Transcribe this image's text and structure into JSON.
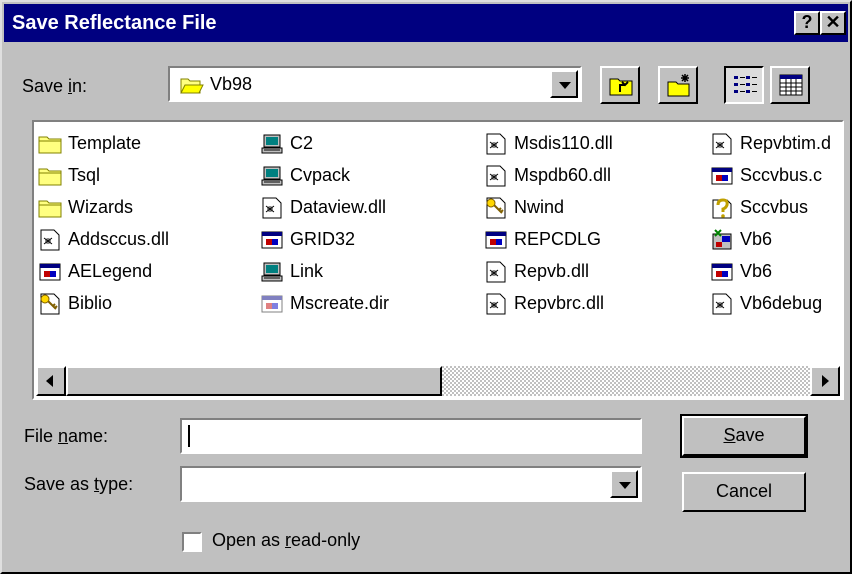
{
  "window": {
    "title": "Save Reflectance File",
    "help_glyph": "?",
    "close_glyph": "✕"
  },
  "save_in": {
    "label_pre": "Save ",
    "label_key": "i",
    "label_post": "n:",
    "value": "Vb98"
  },
  "toolbar": {
    "up_folder": "up-one-level-icon",
    "new_folder": "create-new-folder-icon",
    "list_view": "list-view-icon",
    "details_view": "details-view-icon"
  },
  "files": {
    "columns": [
      [
        {
          "name": "Template",
          "icon": "folder"
        },
        {
          "name": "Tsql",
          "icon": "folder"
        },
        {
          "name": "Wizards",
          "icon": "folder"
        },
        {
          "name": "Addsccus.dll",
          "icon": "dll"
        },
        {
          "name": "AELegend",
          "icon": "exe"
        },
        {
          "name": "Biblio",
          "icon": "key"
        }
      ],
      [
        {
          "name": "C2",
          "icon": "computer"
        },
        {
          "name": "Cvpack",
          "icon": "computer"
        },
        {
          "name": "Dataview.dll",
          "icon": "dll"
        },
        {
          "name": "GRID32",
          "icon": "exe"
        },
        {
          "name": "Link",
          "icon": "computer"
        },
        {
          "name": "Mscreate.dir",
          "icon": "exe-light"
        }
      ],
      [
        {
          "name": "Msdis110.dll",
          "icon": "dll"
        },
        {
          "name": "Mspdb60.dll",
          "icon": "dll"
        },
        {
          "name": "Nwind",
          "icon": "key"
        },
        {
          "name": "REPCDLG",
          "icon": "exe"
        },
        {
          "name": "Repvb.dll",
          "icon": "dll"
        },
        {
          "name": "Repvbrc.dll",
          "icon": "dll"
        }
      ],
      [
        {
          "name": "Repvbtim.d",
          "icon": "dll"
        },
        {
          "name": "Sccvbus.c",
          "icon": "exe"
        },
        {
          "name": "Sccvbus",
          "icon": "help"
        },
        {
          "name": "Vb6",
          "icon": "vb"
        },
        {
          "name": "Vb6",
          "icon": "exe"
        },
        {
          "name": "Vb6debug",
          "icon": "dll"
        }
      ]
    ]
  },
  "file_name": {
    "label_pre": "File ",
    "label_key": "n",
    "label_post": "ame:",
    "value": ""
  },
  "save_as_type": {
    "label_pre": "Save as ",
    "label_key": "t",
    "label_post": "ype:",
    "value": ""
  },
  "buttons": {
    "save_key": "S",
    "save_rest": "ave",
    "cancel": "Cancel"
  },
  "read_only": {
    "label_pre": "Open as ",
    "label_key": "r",
    "label_post": "ead-only",
    "checked": false
  }
}
